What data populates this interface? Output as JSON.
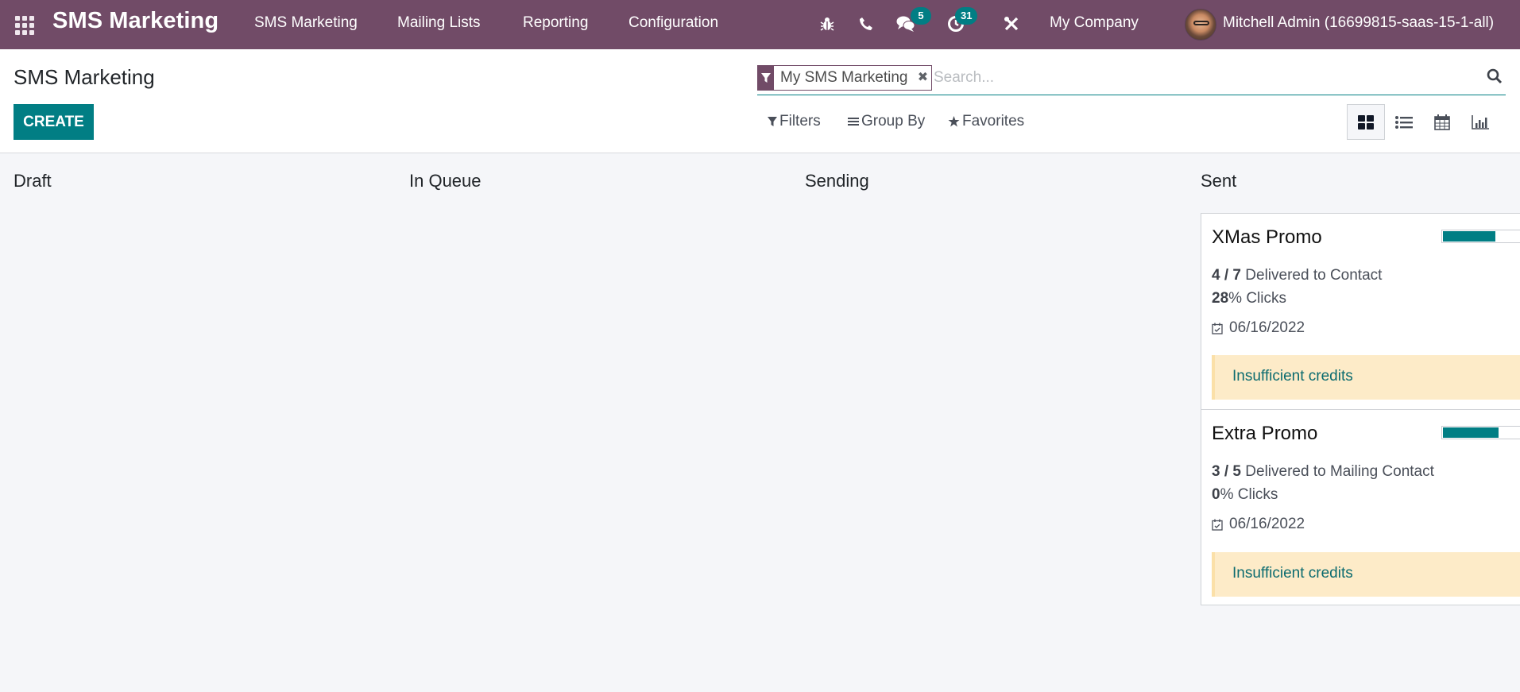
{
  "navbar": {
    "app_name": "SMS Marketing",
    "menu": [
      "SMS Marketing",
      "Mailing Lists",
      "Reporting",
      "Configuration"
    ],
    "messages_badge": "5",
    "activities_badge": "31",
    "company": "My Company",
    "user": "Mitchell Admin (16699815-saas-15-1-all)",
    "icons": [
      "apps-grid-icon",
      "bug-icon",
      "phone-icon",
      "chat-icon",
      "clock-icon",
      "tools-icon"
    ]
  },
  "control_panel": {
    "title": "SMS Marketing",
    "create_label": "CREATE",
    "search": {
      "facet_label": "My SMS Marketing",
      "placeholder": "Search..."
    },
    "filters_label": "Filters",
    "group_by_label": "Group By",
    "favorites_label": "Favorites",
    "views": [
      "kanban",
      "list",
      "calendar",
      "graph"
    ],
    "active_view": "kanban"
  },
  "kanban": {
    "columns": [
      {
        "title": "Draft",
        "cards": []
      },
      {
        "title": "In Queue",
        "cards": []
      },
      {
        "title": "Sending",
        "cards": []
      },
      {
        "title": "Sent",
        "cards": [
          {
            "title": "XMas Promo",
            "delivered": "4",
            "total": "7",
            "separator": " / ",
            "delivered_label": "Delivered to Contact",
            "clicks_value": "28",
            "clicks_label": "% Clicks",
            "date": "06/16/2022",
            "alert": "Insufficient credits",
            "progress_percent": 57
          },
          {
            "title": "Extra Promo",
            "delivered": "3",
            "total": "5",
            "separator": " / ",
            "delivered_label": "Delivered to Mailing Contact",
            "clicks_value": "0",
            "clicks_label": "% Clicks",
            "date": "06/16/2022",
            "alert": "Insufficient credits",
            "progress_percent": 60
          }
        ]
      }
    ]
  },
  "colors": {
    "brand": "#714b67",
    "accent": "#017e84",
    "alert_bg": "#fdebc8"
  }
}
